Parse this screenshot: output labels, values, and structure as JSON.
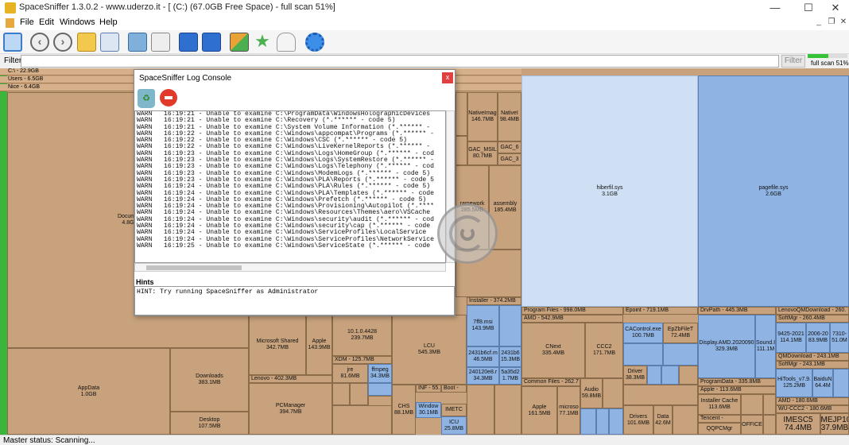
{
  "window": {
    "title": "SpaceSniffer 1.3.0.2 - www.uderzo.it - [ (C:) (67.0GB Free Space) - full scan 51%]",
    "minimize": "—",
    "maximize": "☐",
    "close": "✕"
  },
  "menu": {
    "items": [
      "File",
      "Edit",
      "Windows",
      "Help"
    ],
    "mdi_minimize": "_",
    "mdi_restore": "❐",
    "mdi_close": "✕"
  },
  "toolbar": {
    "icons": [
      "new-scan-icon",
      "back-icon",
      "forward-icon",
      "up-folder-icon",
      "home-icon",
      "refresh-icon",
      "refresh-file-icon",
      "blue-box-icon",
      "blue-box-shield-icon",
      "colored-boxes-icon",
      "star-icon",
      "ghost-icon",
      "settings-gear-icon"
    ]
  },
  "filter": {
    "label": "Filter",
    "value": "",
    "button": "Filter",
    "scan_label": "full scan 51%",
    "scan_progress": 0.51
  },
  "treemap": {
    "path_strips": [
      "C:\\ - 22.9GB",
      "Users - 6.5GB",
      "Nice - 6.4GB"
    ],
    "tiles": {
      "documents": "Docume\n4.8G",
      "appdata": "AppData\n1.0GB",
      "downloads": "Downloads\n383.1MB",
      "desktop": "Desktop\n107.5MB",
      "ms_shared": "Microsoft Shared\n342.7MB",
      "apple": "Apple\n143.9MB",
      "v10": "10.1.0.4428\n239.7MB",
      "xdm": "XDM - 125.7MB",
      "jre": "jre\n81.6MB",
      "ffmpeg": "ffmpeg\n34.3MB",
      "lenovo": "Lenovo - 402.3MB",
      "pcmanager": "PCManager\n394.7MB",
      "lcu": "LCU\n545.3MB",
      "installer": "Installer - 374.2MB",
      "msi": "7ff8.msi\n143.9MB",
      "nativeimg1": "NativeImag\n146.7MB",
      "nativeimg2": "NativeI\n98.4MB",
      "gac_msil": "GAC_MSIL\n80.7MB",
      "gac6": "GAC_6",
      "gac3": "GAC_3",
      "framework": "ramework\n285.5MB",
      "assembly": "assembly\n185.4MB",
      "hiberfil": "hiberfil.sys\n3.1GB",
      "pagefile": "pagefile.sys\n2.6GB",
      "progfiles": "Program Files - 998.0MB",
      "amd": "AMD - 542.9MB",
      "cnext": "CNext\n335.4MB",
      "ccc2": "CCC2\n171.7MB",
      "commonfiles": "Common Files - 262.7",
      "apple2": "Apple\n161.5MB",
      "microsoft2": "microso\n77.1MB",
      "audio": "Audio\n59.8MB",
      "epoint": "Epoint - 719.1MB",
      "cacontrol": "CAControl.exe\n100.7MB",
      "epzb": "EpZbFileT\n72.4MB",
      "driver": "Driver\n38.3MB",
      "drivpath": "DrvPath - 445.3MB",
      "display_amd": "Display.AMD.2020090\n329.3MB",
      "sound": "Sound.I\n111.1M",
      "progdata": "ProgramData - 335.8MB",
      "apple3": "Apple - 113.6MB",
      "installercache": "Installer Cache\n113.6MB",
      "tencent": "Tencent - 72.1MB",
      "qqpcmgr": "QQPCMgr",
      "lenovoqm": "LenovoQMDownload - 260.",
      "softmgr1": "SoftMgr - 260.4MB",
      "f9425": "9425-2021\n114.1MB",
      "f2006": "2006-20\n83.9MB",
      "f7310": "7310-\n51.0M",
      "qmdownload": "QMDownload - 243.1MB",
      "softmgr2": "SoftMgr - 243.1MB",
      "hitools": "HiTools_v7.9.\n125.2MB",
      "baidu": "BaiduN\n64.4M",
      "amd2": "AMD - 180.6MB",
      "wuccc2": "WU-CCC2 - 180.6MB",
      "imesc5": "IMESC5\n74.4MB",
      "imejp": "IMEJP10\n37.9MB",
      "office": "OFFICE",
      "lcu_drivers": "Drivers\n101.6MB",
      "lcu_data": "Data\n42.6M",
      "chs": "CHS\n88.1MB",
      "inf": "INF - 55.",
      "boot": "Boot - 36.0",
      "window1": "Window\n30.1MB",
      "icu": "ICU\n25.8MB",
      "imetc": "IMETC",
      "f2431b6c": "2431b6cf.m\n46.5MB",
      "f2431b6": "2431b6\n15.3MB",
      "f240120": "240120e8.r\n34.3MB",
      "f5a35": "5a35d2\n1.7MB"
    }
  },
  "console": {
    "title": "SpaceSniffer Log Console",
    "close": "x",
    "log": [
      "WARN   16:19:21 - Unable to examine C:\\ProgramData\\WindowsHolographicDevices",
      "WARN   16:19:21 - Unable to examine C:\\Recovery (*.****** - code 5)",
      "WARN   16:19:21 - Unable to examine C:\\System Volume Information (*.****** - ",
      "WARN   16:19:22 - Unable to examine C:\\Windows\\appcompat\\Programs (*.****** - ",
      "WARN   16:19:22 - Unable to examine C:\\Windows\\CSC (*.****** - code 5)",
      "WARN   16:19:22 - Unable to examine C:\\Windows\\LiveKernelReports (*.****** - ",
      "WARN   16:19:23 - Unable to examine C:\\Windows\\Logs\\HomeGroup (*.****** - cod",
      "WARN   16:19:23 - Unable to examine C:\\Windows\\Logs\\SystemRestore (*.****** -",
      "WARN   16:19:23 - Unable to examine C:\\Windows\\Logs\\Telephony (*.****** - cod",
      "WARN   16:19:23 - Unable to examine C:\\Windows\\ModemLogs (*.****** - code 5)",
      "WARN   16:19:23 - Unable to examine C:\\Windows\\PLA\\Reports (*.****** - code 5",
      "WARN   16:19:24 - Unable to examine C:\\Windows\\PLA\\Rules (*.****** - code 5)",
      "WARN   16:19:24 - Unable to examine C:\\Windows\\PLA\\Templates (*.****** - code",
      "WARN   16:19:24 - Unable to examine C:\\Windows\\Prefetch (*.****** - code 5)",
      "WARN   16:19:24 - Unable to examine C:\\Windows\\Provisioning\\Autopilot (*.****",
      "WARN   16:19:24 - Unable to examine C:\\Windows\\Resources\\Themes\\aero\\VSCache",
      "WARN   16:19:24 - Unable to examine C:\\Windows\\security\\audit (*.****** - cod",
      "WARN   16:19:24 - Unable to examine C:\\Windows\\security\\cap (*.****** - code",
      "WARN   16:19:24 - Unable to examine C:\\Windows\\ServiceProfiles\\LocalService",
      "WARN   16:19:24 - Unable to examine C:\\Windows\\ServiceProfiles\\NetworkService",
      "WARN   16:19:25 - Unable to examine C:\\Windows\\ServiceState (*.****** - code"
    ],
    "hints_label": "Hints",
    "hint": "HINT: Try running SpaceSniffer as Administrator"
  },
  "status": {
    "text": "Master status: Scanning..."
  }
}
